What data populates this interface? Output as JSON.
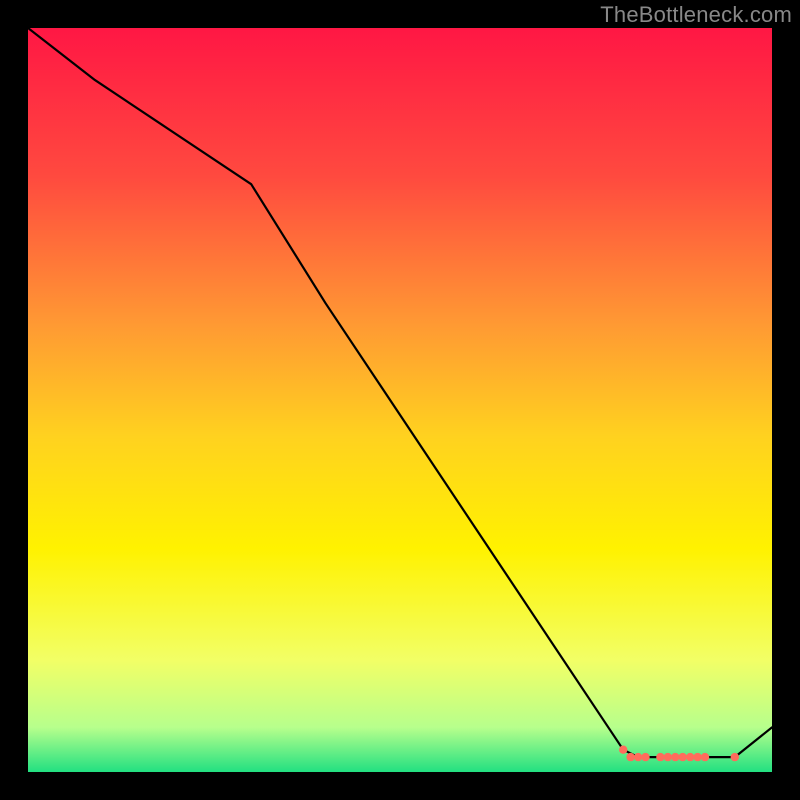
{
  "watermark": "TheBottleneck.com",
  "chart_data": {
    "type": "line",
    "title": "",
    "xlabel": "",
    "ylabel": "",
    "xlim": [
      0,
      100
    ],
    "ylim": [
      0,
      100
    ],
    "grid": false,
    "legend": false,
    "background_gradient_stops": [
      {
        "offset": 0.0,
        "color": "#ff1744"
      },
      {
        "offset": 0.2,
        "color": "#ff4a3f"
      },
      {
        "offset": 0.4,
        "color": "#ff9a33"
      },
      {
        "offset": 0.55,
        "color": "#ffd21f"
      },
      {
        "offset": 0.7,
        "color": "#fff200"
      },
      {
        "offset": 0.85,
        "color": "#f2ff66"
      },
      {
        "offset": 0.94,
        "color": "#b7ff8c"
      },
      {
        "offset": 1.0,
        "color": "#22e081"
      }
    ],
    "line": {
      "color": "#000000",
      "width": 2.2,
      "x": [
        0,
        9,
        18,
        30,
        40,
        50,
        60,
        70,
        80,
        82,
        84,
        88,
        92,
        95,
        100
      ],
      "y": [
        100,
        93,
        87,
        79,
        63,
        48,
        33,
        18,
        3,
        2,
        2,
        2,
        2,
        2,
        6
      ]
    },
    "marker_band": {
      "color": "#ff6c5c",
      "radius": 4.2,
      "points": [
        {
          "x": 80,
          "y": 3
        },
        {
          "x": 81,
          "y": 2
        },
        {
          "x": 82,
          "y": 2
        },
        {
          "x": 83,
          "y": 2
        },
        {
          "x": 85,
          "y": 2
        },
        {
          "x": 86,
          "y": 2
        },
        {
          "x": 87,
          "y": 2
        },
        {
          "x": 88,
          "y": 2
        },
        {
          "x": 89,
          "y": 2
        },
        {
          "x": 90,
          "y": 2
        },
        {
          "x": 91,
          "y": 2
        },
        {
          "x": 95,
          "y": 2
        }
      ]
    }
  }
}
